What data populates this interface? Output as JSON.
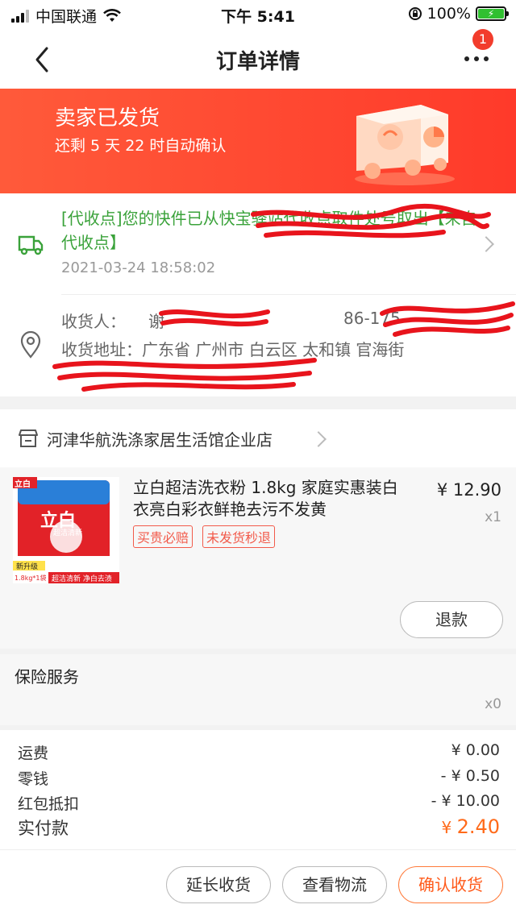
{
  "status_bar": {
    "carrier": "中国联通",
    "time": "下午 5:41",
    "battery": "100%"
  },
  "nav": {
    "title": "订单详情",
    "badge": "1"
  },
  "banner": {
    "title": "卖家已发货",
    "subtitle": "还剩 5 天 22 时自动确认"
  },
  "logistics": {
    "message": "[代收点]您的快件已从快宝驿站代收点取件处号取出【来自代收点】",
    "time": "2021-03-24 18:58:02"
  },
  "address": {
    "receiver_label": "收货人：",
    "receiver_name": "谢",
    "phone": "86-175",
    "address_label": "收货地址：",
    "address": "广东省 广州市 白云区 太和镇 官海街"
  },
  "shop": {
    "name": "河津华航洗涤家居生活馆企业店"
  },
  "item": {
    "name": "立白超洁洗衣粉 1.8kg 家庭实惠装白衣亮白彩衣鲜艳去污不发黄",
    "price": "¥ 12.90",
    "qty": "x1",
    "tags": [
      "买贵必赔",
      "未发货秒退"
    ],
    "refund": "退款",
    "image_text": {
      "brand_corner": "立白",
      "brand": "立白",
      "sub": "超洁清新",
      "badge": "新升级",
      "weight": "1.8kg*1袋",
      "slogan": "超洁清新 净白去渍"
    }
  },
  "insurance": {
    "label": "保险服务",
    "qty": "x0"
  },
  "fees": {
    "shipping": {
      "label": "运费",
      "value": "¥ 0.00"
    },
    "change": {
      "label": "零钱",
      "value": "- ¥ 0.50"
    },
    "redpack": {
      "label": "红包抵扣",
      "value": "- ¥ 10.00"
    },
    "total": {
      "label": "实付款",
      "currency": "¥ ",
      "amount": "2.40"
    }
  },
  "actions": {
    "extend": "延长收货",
    "logistics": "查看物流",
    "confirm": "确认收货"
  },
  "colors": {
    "accent": "#ff4a2e",
    "logistics_green": "#3aa23a",
    "tag_red": "#f25a4a",
    "price_orange": "#ff6a1a"
  }
}
